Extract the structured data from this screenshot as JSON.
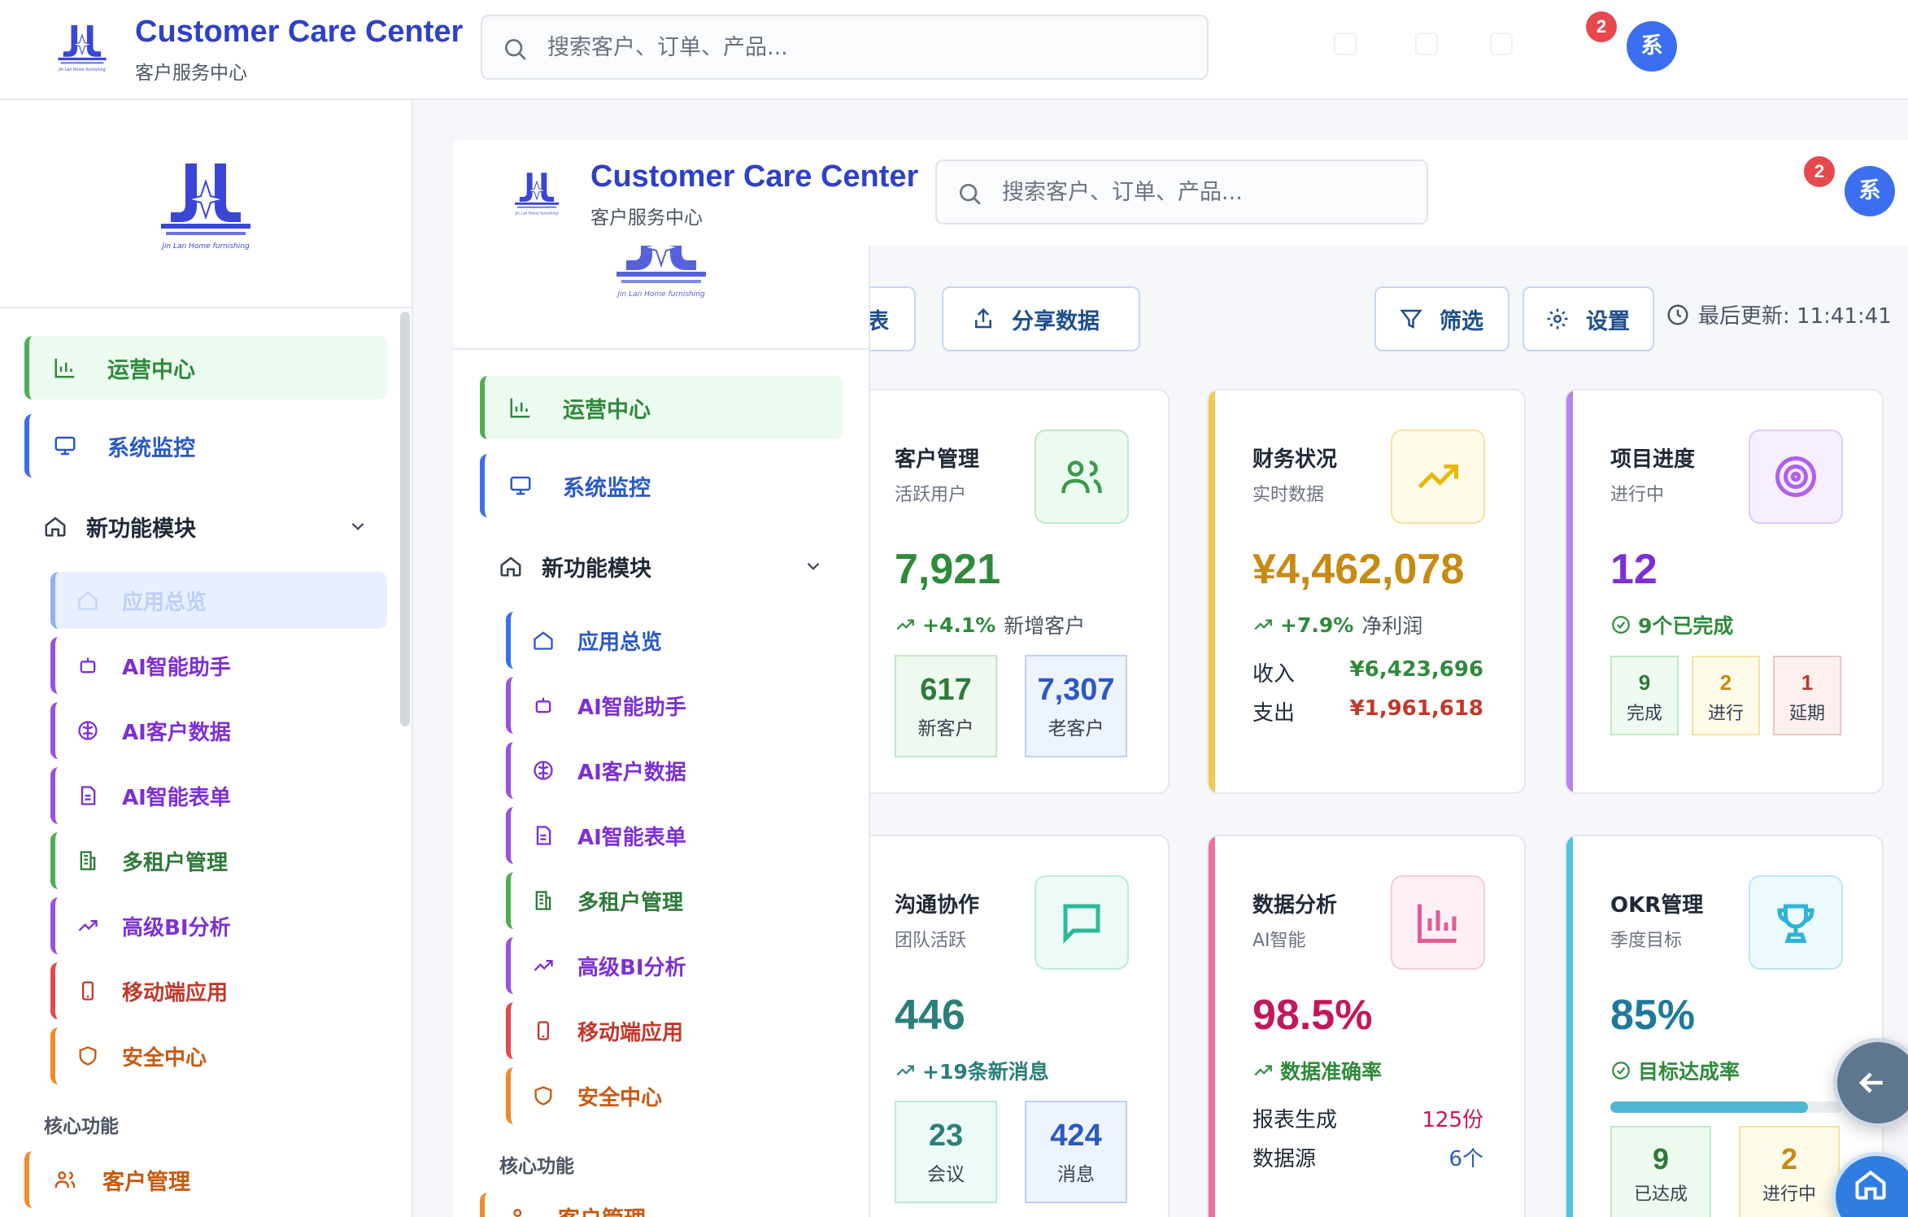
{
  "header": {
    "title": "Customer Care Center",
    "subtitle": "客户服务中心",
    "search_placeholder": "搜索客户、订单、产品...",
    "notification_count": "2",
    "avatar_label": "系",
    "logo_caption": "Jin Lan Home furnishing"
  },
  "sidebar": {
    "items": [
      {
        "label": "运营中心",
        "icon": "bar-chart-icon",
        "color": "#2f8a3c"
      },
      {
        "label": "系统监控",
        "icon": "monitor-icon",
        "color": "#2b59c3"
      }
    ],
    "group": {
      "label": "新功能模块",
      "icon": "home-icon"
    },
    "sub_items": [
      {
        "label": "应用总览",
        "icon": "home-icon",
        "color": "#2b59c3"
      },
      {
        "label": "AI智能助手",
        "icon": "bot-icon",
        "color": "#7e2fd4"
      },
      {
        "label": "AI客户数据",
        "icon": "brain-icon",
        "color": "#7e2fd4"
      },
      {
        "label": "AI智能表单",
        "icon": "file-text-icon",
        "color": "#7e2fd4"
      },
      {
        "label": "多租户管理",
        "icon": "building-icon",
        "color": "#2f7a3a"
      },
      {
        "label": "高级BI分析",
        "icon": "trending-up-icon",
        "color": "#7e2fd4"
      },
      {
        "label": "移动端应用",
        "icon": "smartphone-icon",
        "color": "#c0392b"
      },
      {
        "label": "安全中心",
        "icon": "shield-icon",
        "color": "#c75a12"
      }
    ],
    "section_label": "核心功能",
    "core_items": [
      {
        "label": "客户管理",
        "icon": "users-icon",
        "color": "#c75a12"
      }
    ]
  },
  "toolbar": {
    "export_partial": "表",
    "share_label": "分享数据",
    "filter_label": "筛选",
    "settings_label": "设置",
    "updated_label": "最后更新: 11:41:41"
  },
  "cards": [
    {
      "title": "客户管理",
      "subtitle": "活跃用户",
      "value": "7,921",
      "trend_value": "+4.1%",
      "trend_note": "新增客户",
      "minis": [
        {
          "value": "617",
          "label": "新客户"
        },
        {
          "value": "7,307",
          "label": "老客户"
        }
      ]
    },
    {
      "title": "财务状况",
      "subtitle": "实时数据",
      "value": "¥4,462,078",
      "trend_value": "+7.9%",
      "trend_note": "净利润",
      "rows": [
        {
          "label": "收入",
          "value": "¥6,423,696"
        },
        {
          "label": "支出",
          "value": "¥1,961,618"
        }
      ]
    },
    {
      "title": "项目进度",
      "subtitle": "进行中",
      "value": "12",
      "status": "9个已完成",
      "minis": [
        {
          "value": "9",
          "label": "完成"
        },
        {
          "value": "2",
          "label": "进行"
        },
        {
          "value": "1",
          "label": "延期"
        }
      ]
    },
    {
      "title": "沟通协作",
      "subtitle": "团队活跃",
      "value": "446",
      "trend_value": "+19条新消息",
      "trend_note": "",
      "minis": [
        {
          "value": "23",
          "label": "会议"
        },
        {
          "value": "424",
          "label": "消息"
        }
      ]
    },
    {
      "title": "数据分析",
      "subtitle": "AI智能",
      "value": "98.5%",
      "trend_value": "数据准确率",
      "trend_note": "",
      "rows": [
        {
          "label": "报表生成",
          "value": "125份"
        },
        {
          "label": "数据源",
          "value": "6个"
        }
      ]
    },
    {
      "title": "OKR管理",
      "subtitle": "季度目标",
      "value": "85%",
      "status": "目标达成率",
      "progress": 0.85,
      "minis": [
        {
          "value": "9",
          "label": "已达成"
        },
        {
          "value": "2",
          "label": "进行中"
        }
      ]
    }
  ],
  "colors": {
    "brand": "#2e41c6",
    "green": "#2f8a3c",
    "blue": "#2b59c3",
    "purple": "#7e2fd4",
    "orange": "#c75a12",
    "red": "#c0392b",
    "gold": "#c78a12",
    "teal": "#2a7f7a",
    "pink": "#c2185b",
    "cyan": "#1f7a9a"
  }
}
